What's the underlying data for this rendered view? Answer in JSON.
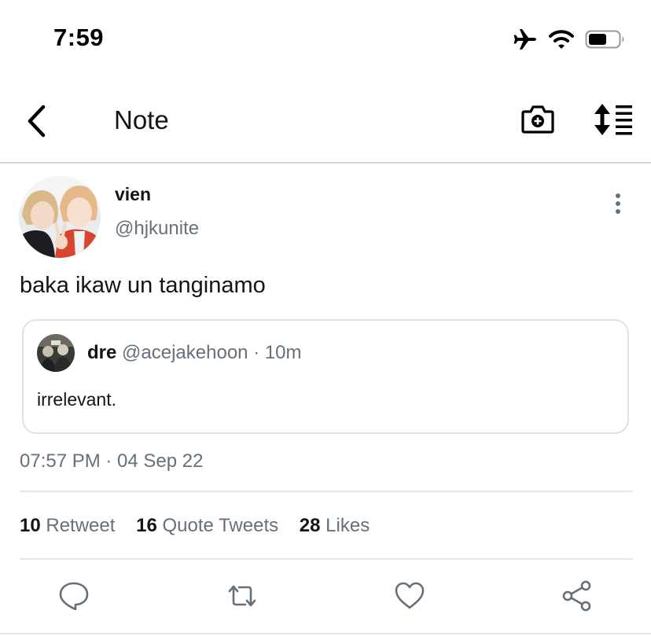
{
  "status_bar": {
    "time": "7:59",
    "icons": [
      "airplane-icon",
      "wifi-icon",
      "battery-icon"
    ]
  },
  "nav": {
    "title": "Note",
    "back_icon": "chevron-left-icon",
    "camera_icon": "camera-plus-icon",
    "sort_icon": "sort-list-icon"
  },
  "tweet": {
    "author_name": "vien",
    "author_handle": "@hjkunite",
    "text": "baka ikaw un tanginamo",
    "timestamp": "07:57 PM · 04 Sep 22",
    "quote": {
      "name": "dre",
      "meta": "@acejakehoon · 10m",
      "text": "irrelevant."
    }
  },
  "stats": [
    {
      "count": "10",
      "label": "Retweet"
    },
    {
      "count": "16",
      "label": "Quote Tweets"
    },
    {
      "count": "28",
      "label": "Likes"
    }
  ],
  "actions": [
    "reply-icon",
    "retweet-icon",
    "like-icon",
    "share-icon"
  ],
  "colors": {
    "text": "#141414",
    "secondary": "#65707b",
    "border": "#dfe3e7"
  }
}
